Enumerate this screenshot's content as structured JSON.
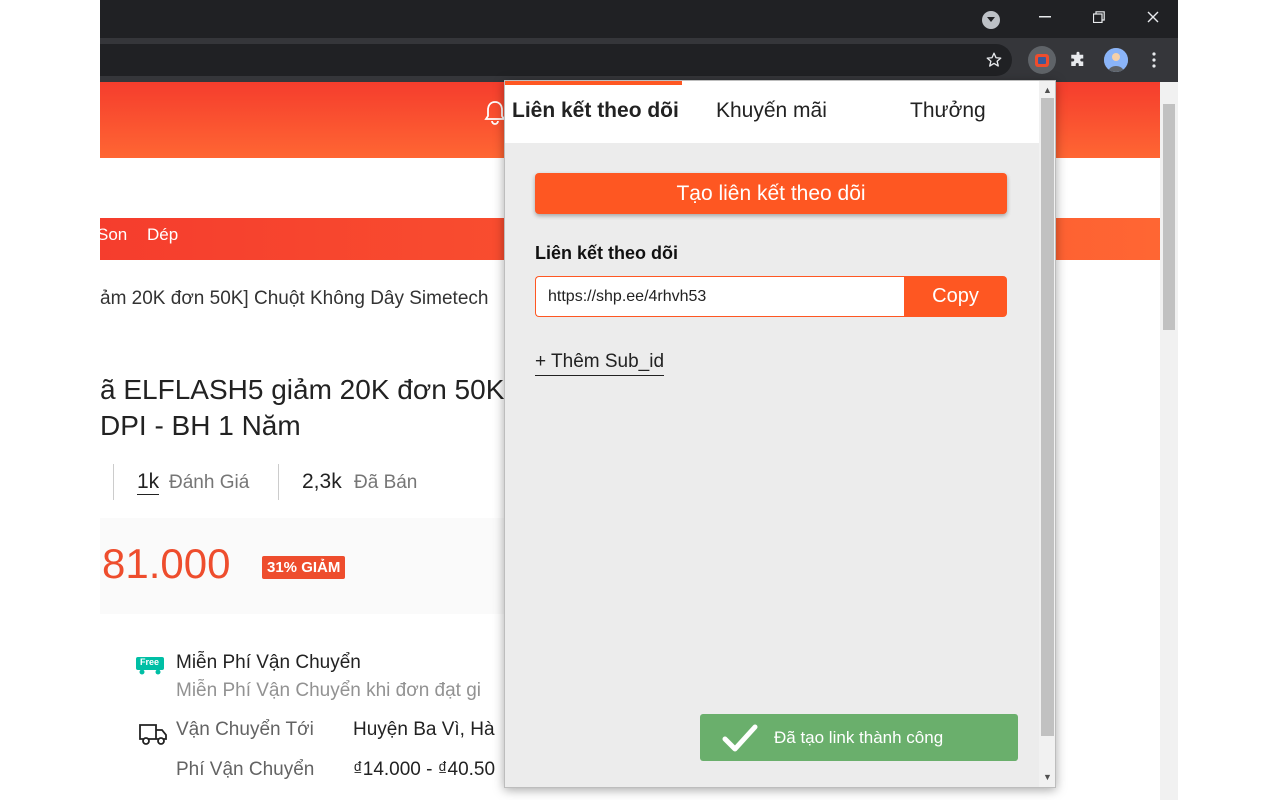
{
  "browser": {
    "toolbar_icons": [
      "star-icon",
      "shopee-extension-icon",
      "puzzle-icon",
      "profile-avatar",
      "kebab-menu-icon"
    ],
    "window_controls": [
      "minimize-icon",
      "restore-icon",
      "close-icon"
    ]
  },
  "page": {
    "categories": [
      "Son",
      "Dép"
    ],
    "breadcrumb": "ảm 20K đơn 50K] Chuột Không Dây Simetech",
    "title_line1": "ã ELFLASH5 giảm 20K đơn 50K",
    "title_line2": "DPI - BH 1 Năm",
    "reviews_count": "1k",
    "reviews_label": "Đánh Giá",
    "sold_count": "2,3k",
    "sold_label": "Đã Bán",
    "price": "81.000",
    "discount": "31% GIẢM",
    "free_ship_badge": "Free",
    "free_ship_title": "Miễn Phí Vận Chuyển",
    "free_ship_desc": "Miễn Phí Vận Chuyển khi đơn đạt gi",
    "ship_to_label": "Vận Chuyển Tới",
    "ship_to_value": "Huyện Ba Vì, Hà",
    "ship_fee_label": "Phí Vận Chuyển",
    "ship_fee_value": "₫14.000 - ₫40.50"
  },
  "popup": {
    "tabs": [
      {
        "label": "Liên kết theo dõi",
        "active": true
      },
      {
        "label": "Khuyến mãi",
        "active": false
      },
      {
        "label": "Thưởng",
        "active": false
      }
    ],
    "create_button": "Tạo liên kết theo dõi",
    "link_label": "Liên kết theo dõi",
    "link_value": "https://shp.ee/4rhvh53",
    "copy_button": "Copy",
    "add_subid": "+ Thêm Sub_id",
    "toast": "Đã tạo link thành công"
  },
  "colors": {
    "shopee_orange": "#ee4d2d",
    "accent": "#fe5722",
    "toast_green": "#6aaf6c",
    "chrome_dark": "#202124"
  }
}
